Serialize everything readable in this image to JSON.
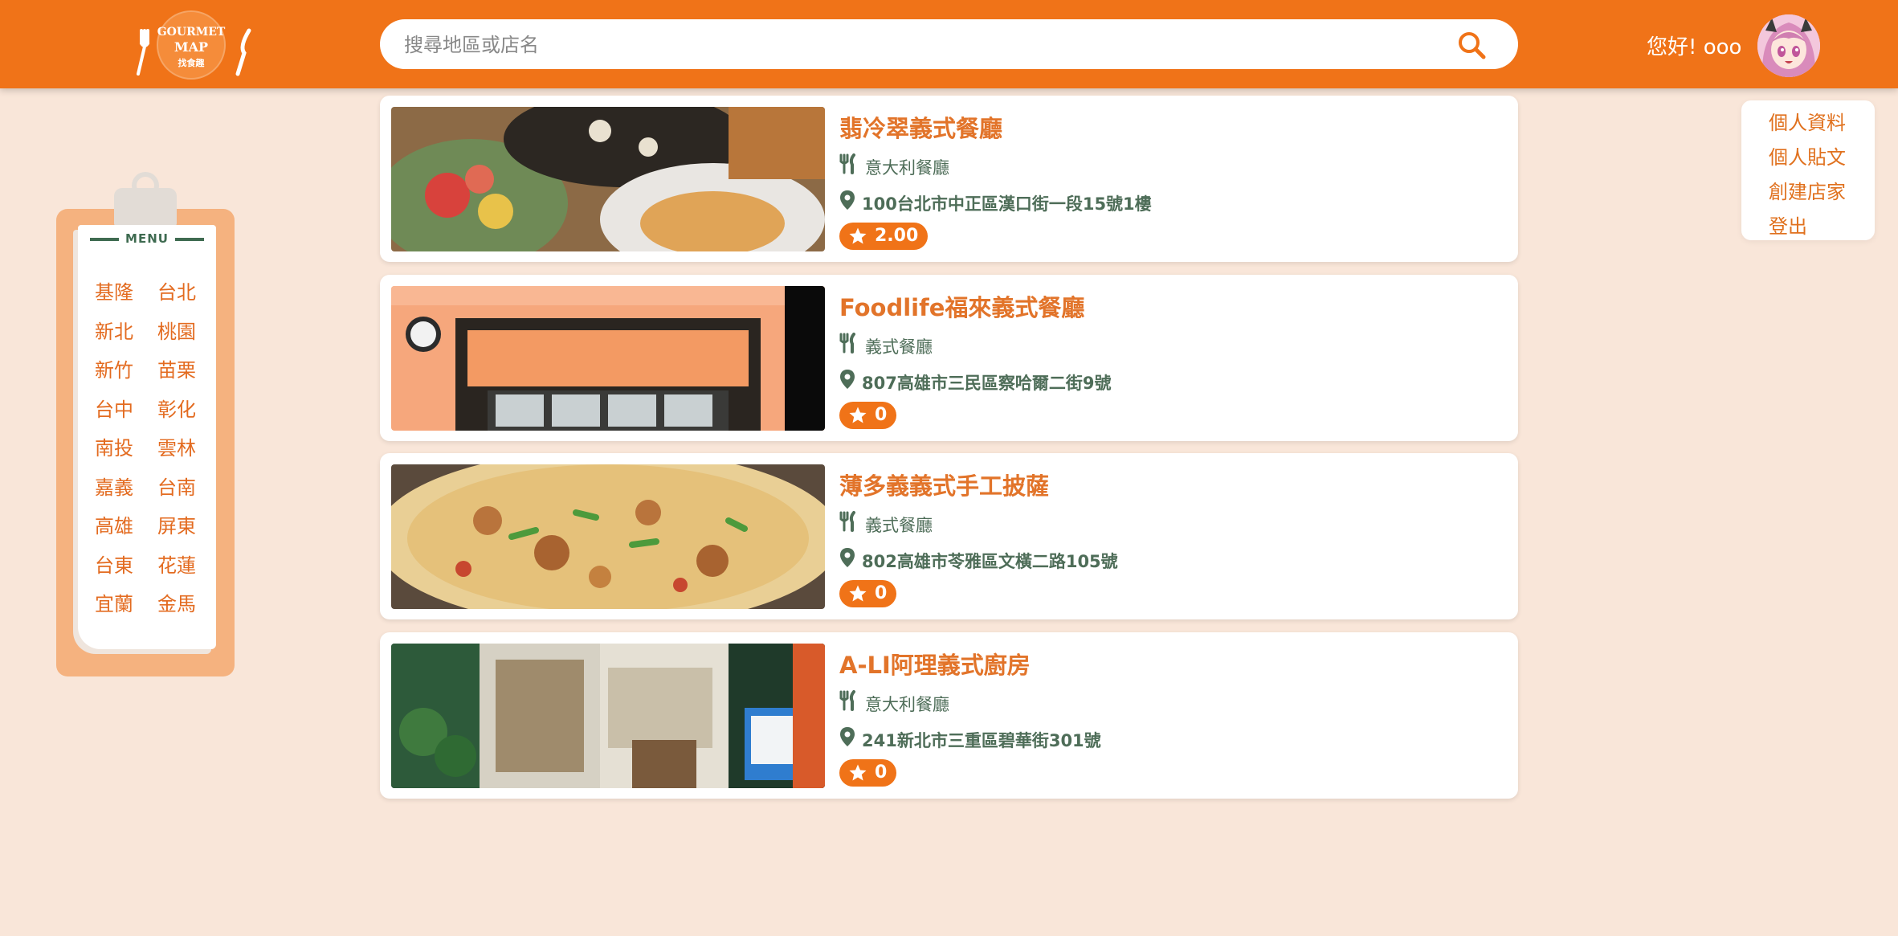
{
  "header": {
    "logo_text": [
      "GOURMET",
      "MAP",
      "找食趣"
    ],
    "search": {
      "placeholder": "搜尋地區或店名"
    },
    "greeting": "您好! ooo"
  },
  "user_menu": {
    "items": [
      "個人資料",
      "個人貼文",
      "創建店家",
      "登出"
    ]
  },
  "sidebar": {
    "title": "MENU",
    "cities": [
      "基隆",
      "台北",
      "新北",
      "桃園",
      "新竹",
      "苗栗",
      "台中",
      "彰化",
      "南投",
      "雲林",
      "嘉義",
      "台南",
      "高雄",
      "屏東",
      "台東",
      "花蓮",
      "宜蘭",
      "金馬"
    ]
  },
  "restaurants": [
    {
      "name": "翡冷翠義式餐廳",
      "category": "意大利餐廳",
      "address": "100台北市中正區漢口街一段15號1樓",
      "rating": "2.00"
    },
    {
      "name": "Foodlife福來義式餐廳",
      "category": "義式餐廳",
      "address": "807高雄市三民區察哈爾二街9號",
      "rating": "0"
    },
    {
      "name": "薄多義義式手工披薩",
      "category": "義式餐廳",
      "address": "802高雄市苓雅區文橫二路105號",
      "rating": "0"
    },
    {
      "name": "A-LI阿理義式廚房",
      "category": "意大利餐廳",
      "address": "241新北市三重區碧華街301號",
      "rating": "0"
    }
  ],
  "colors": {
    "brand_orange": "#f07318",
    "page_background": "#f9e6d9",
    "accent_green": "#4e6d58"
  }
}
